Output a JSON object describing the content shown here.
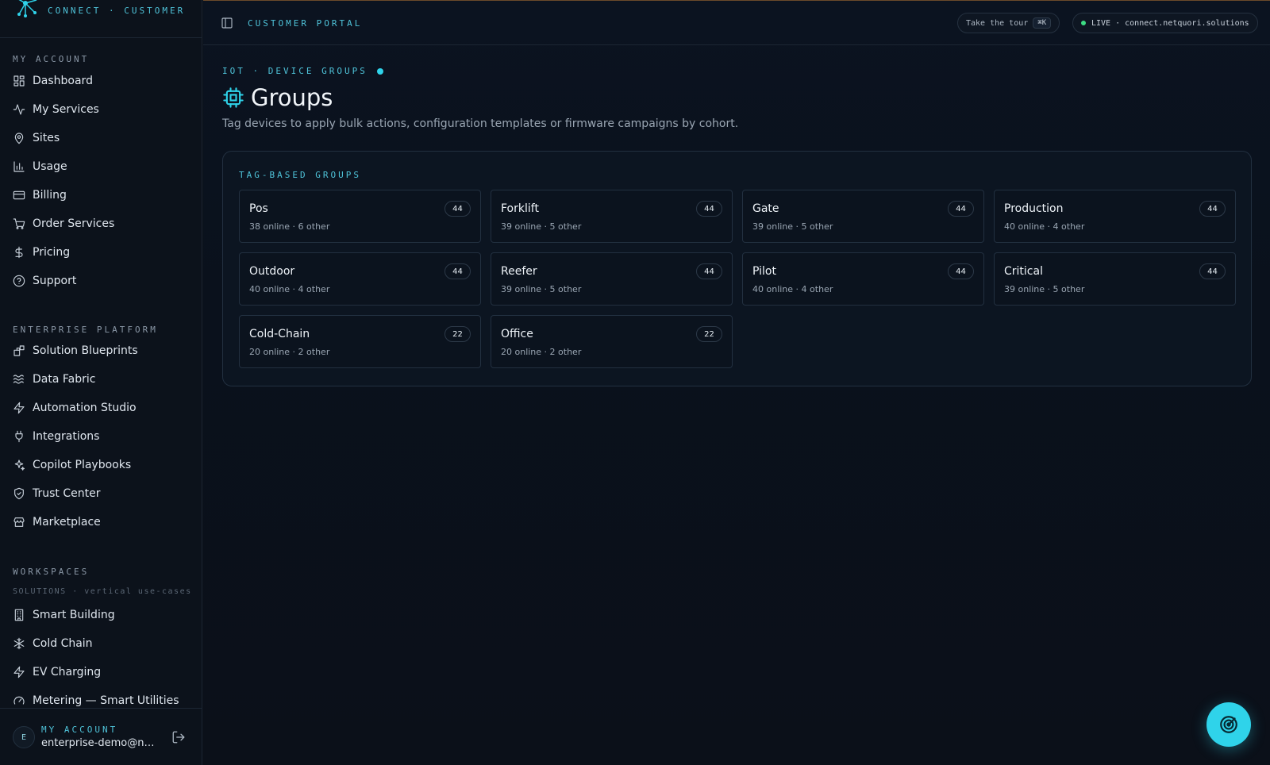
{
  "brand": {
    "subtitle": "CONNECT · CUSTOMER"
  },
  "sections": {
    "my_account": "MY ACCOUNT",
    "enterprise": "ENTERPRISE PLATFORM",
    "workspaces": "WORKSPACES",
    "workspaces_sub": "SOLUTIONS · vertical use-cases"
  },
  "nav": {
    "my_account": [
      {
        "label": "Dashboard",
        "icon": "dashboard-icon"
      },
      {
        "label": "My Services",
        "icon": "activity-icon"
      },
      {
        "label": "Sites",
        "icon": "map-pin-icon"
      },
      {
        "label": "Usage",
        "icon": "bar-chart-icon"
      },
      {
        "label": "Billing",
        "icon": "credit-card-icon"
      },
      {
        "label": "Order Services",
        "icon": "cart-icon"
      },
      {
        "label": "Pricing",
        "icon": "dollar-icon"
      },
      {
        "label": "Support",
        "icon": "help-circle-icon"
      }
    ],
    "enterprise": [
      {
        "label": "Solution Blueprints",
        "icon": "blocks-icon"
      },
      {
        "label": "Data Fabric",
        "icon": "waves-icon"
      },
      {
        "label": "Automation Studio",
        "icon": "zap-icon"
      },
      {
        "label": "Integrations",
        "icon": "plug-icon"
      },
      {
        "label": "Copilot Playbooks",
        "icon": "sparkles-icon"
      },
      {
        "label": "Trust Center",
        "icon": "shield-icon"
      },
      {
        "label": "Marketplace",
        "icon": "store-icon"
      }
    ],
    "workspaces": [
      {
        "label": "Smart Building",
        "icon": "building-icon"
      },
      {
        "label": "Cold Chain",
        "icon": "snowflake-icon"
      },
      {
        "label": "EV Charging",
        "icon": "zap-icon"
      },
      {
        "label": "Metering — Smart Utilities",
        "icon": "gauge-icon"
      }
    ]
  },
  "account": {
    "avatar": "E",
    "label": "MY ACCOUNT",
    "email": "enterprise-demo@netquori.solutions"
  },
  "topbar": {
    "title": "CUSTOMER PORTAL",
    "tour_label": "Take the tour",
    "tour_kbd": "⌘K",
    "live_label": "LIVE · connect.netquori.solutions"
  },
  "page": {
    "breadcrumb": "IOT · DEVICE GROUPS",
    "title": "Groups",
    "description": "Tag devices to apply bulk actions, configuration templates or firmware campaigns by cohort.",
    "section_label": "TAG-BASED GROUPS"
  },
  "groups": [
    {
      "name": "Pos",
      "count": "44",
      "meta": "38 online · 6 other"
    },
    {
      "name": "Forklift",
      "count": "44",
      "meta": "39 online · 5 other"
    },
    {
      "name": "Gate",
      "count": "44",
      "meta": "39 online · 5 other"
    },
    {
      "name": "Production",
      "count": "44",
      "meta": "40 online · 4 other"
    },
    {
      "name": "Outdoor",
      "count": "44",
      "meta": "40 online · 4 other"
    },
    {
      "name": "Reefer",
      "count": "44",
      "meta": "39 online · 5 other"
    },
    {
      "name": "Pilot",
      "count": "44",
      "meta": "40 online · 4 other"
    },
    {
      "name": "Critical",
      "count": "44",
      "meta": "39 online · 5 other"
    },
    {
      "name": "Cold-Chain",
      "count": "22",
      "meta": "20 online · 2 other"
    },
    {
      "name": "Office",
      "count": "22",
      "meta": "20 online · 2 other"
    }
  ],
  "colors": {
    "accent": "#2fd3ea",
    "live": "#3ddc84",
    "background": "#0a1018"
  }
}
